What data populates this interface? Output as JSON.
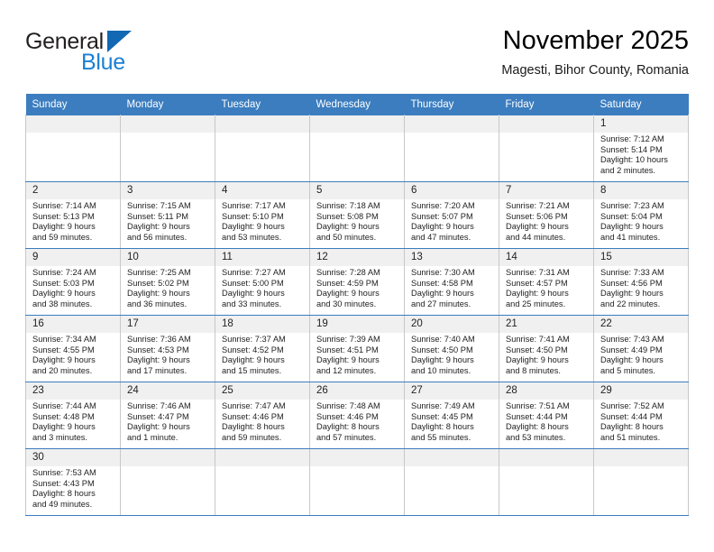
{
  "brand": {
    "name_top": "General",
    "name_bottom": "Blue",
    "accent_color": "#1268b3",
    "blue_text_color": "#1a7fd4"
  },
  "header": {
    "title": "November 2025",
    "subtitle": "Magesti, Bihor County, Romania"
  },
  "calendar": {
    "header_bg": "#3b7dbf",
    "daynum_bg": "#f0f0f0",
    "weekdays": [
      "Sunday",
      "Monday",
      "Tuesday",
      "Wednesday",
      "Thursday",
      "Friday",
      "Saturday"
    ],
    "weeks": [
      [
        {
          "day": "",
          "sunrise": "",
          "sunset": "",
          "daylight": "",
          "daylight2": ""
        },
        {
          "day": "",
          "sunrise": "",
          "sunset": "",
          "daylight": "",
          "daylight2": ""
        },
        {
          "day": "",
          "sunrise": "",
          "sunset": "",
          "daylight": "",
          "daylight2": ""
        },
        {
          "day": "",
          "sunrise": "",
          "sunset": "",
          "daylight": "",
          "daylight2": ""
        },
        {
          "day": "",
          "sunrise": "",
          "sunset": "",
          "daylight": "",
          "daylight2": ""
        },
        {
          "day": "",
          "sunrise": "",
          "sunset": "",
          "daylight": "",
          "daylight2": ""
        },
        {
          "day": "1",
          "sunrise": "Sunrise: 7:12 AM",
          "sunset": "Sunset: 5:14 PM",
          "daylight": "Daylight: 10 hours",
          "daylight2": "and 2 minutes."
        }
      ],
      [
        {
          "day": "2",
          "sunrise": "Sunrise: 7:14 AM",
          "sunset": "Sunset: 5:13 PM",
          "daylight": "Daylight: 9 hours",
          "daylight2": "and 59 minutes."
        },
        {
          "day": "3",
          "sunrise": "Sunrise: 7:15 AM",
          "sunset": "Sunset: 5:11 PM",
          "daylight": "Daylight: 9 hours",
          "daylight2": "and 56 minutes."
        },
        {
          "day": "4",
          "sunrise": "Sunrise: 7:17 AM",
          "sunset": "Sunset: 5:10 PM",
          "daylight": "Daylight: 9 hours",
          "daylight2": "and 53 minutes."
        },
        {
          "day": "5",
          "sunrise": "Sunrise: 7:18 AM",
          "sunset": "Sunset: 5:08 PM",
          "daylight": "Daylight: 9 hours",
          "daylight2": "and 50 minutes."
        },
        {
          "day": "6",
          "sunrise": "Sunrise: 7:20 AM",
          "sunset": "Sunset: 5:07 PM",
          "daylight": "Daylight: 9 hours",
          "daylight2": "and 47 minutes."
        },
        {
          "day": "7",
          "sunrise": "Sunrise: 7:21 AM",
          "sunset": "Sunset: 5:06 PM",
          "daylight": "Daylight: 9 hours",
          "daylight2": "and 44 minutes."
        },
        {
          "day": "8",
          "sunrise": "Sunrise: 7:23 AM",
          "sunset": "Sunset: 5:04 PM",
          "daylight": "Daylight: 9 hours",
          "daylight2": "and 41 minutes."
        }
      ],
      [
        {
          "day": "9",
          "sunrise": "Sunrise: 7:24 AM",
          "sunset": "Sunset: 5:03 PM",
          "daylight": "Daylight: 9 hours",
          "daylight2": "and 38 minutes."
        },
        {
          "day": "10",
          "sunrise": "Sunrise: 7:25 AM",
          "sunset": "Sunset: 5:02 PM",
          "daylight": "Daylight: 9 hours",
          "daylight2": "and 36 minutes."
        },
        {
          "day": "11",
          "sunrise": "Sunrise: 7:27 AM",
          "sunset": "Sunset: 5:00 PM",
          "daylight": "Daylight: 9 hours",
          "daylight2": "and 33 minutes."
        },
        {
          "day": "12",
          "sunrise": "Sunrise: 7:28 AM",
          "sunset": "Sunset: 4:59 PM",
          "daylight": "Daylight: 9 hours",
          "daylight2": "and 30 minutes."
        },
        {
          "day": "13",
          "sunrise": "Sunrise: 7:30 AM",
          "sunset": "Sunset: 4:58 PM",
          "daylight": "Daylight: 9 hours",
          "daylight2": "and 27 minutes."
        },
        {
          "day": "14",
          "sunrise": "Sunrise: 7:31 AM",
          "sunset": "Sunset: 4:57 PM",
          "daylight": "Daylight: 9 hours",
          "daylight2": "and 25 minutes."
        },
        {
          "day": "15",
          "sunrise": "Sunrise: 7:33 AM",
          "sunset": "Sunset: 4:56 PM",
          "daylight": "Daylight: 9 hours",
          "daylight2": "and 22 minutes."
        }
      ],
      [
        {
          "day": "16",
          "sunrise": "Sunrise: 7:34 AM",
          "sunset": "Sunset: 4:55 PM",
          "daylight": "Daylight: 9 hours",
          "daylight2": "and 20 minutes."
        },
        {
          "day": "17",
          "sunrise": "Sunrise: 7:36 AM",
          "sunset": "Sunset: 4:53 PM",
          "daylight": "Daylight: 9 hours",
          "daylight2": "and 17 minutes."
        },
        {
          "day": "18",
          "sunrise": "Sunrise: 7:37 AM",
          "sunset": "Sunset: 4:52 PM",
          "daylight": "Daylight: 9 hours",
          "daylight2": "and 15 minutes."
        },
        {
          "day": "19",
          "sunrise": "Sunrise: 7:39 AM",
          "sunset": "Sunset: 4:51 PM",
          "daylight": "Daylight: 9 hours",
          "daylight2": "and 12 minutes."
        },
        {
          "day": "20",
          "sunrise": "Sunrise: 7:40 AM",
          "sunset": "Sunset: 4:50 PM",
          "daylight": "Daylight: 9 hours",
          "daylight2": "and 10 minutes."
        },
        {
          "day": "21",
          "sunrise": "Sunrise: 7:41 AM",
          "sunset": "Sunset: 4:50 PM",
          "daylight": "Daylight: 9 hours",
          "daylight2": "and 8 minutes."
        },
        {
          "day": "22",
          "sunrise": "Sunrise: 7:43 AM",
          "sunset": "Sunset: 4:49 PM",
          "daylight": "Daylight: 9 hours",
          "daylight2": "and 5 minutes."
        }
      ],
      [
        {
          "day": "23",
          "sunrise": "Sunrise: 7:44 AM",
          "sunset": "Sunset: 4:48 PM",
          "daylight": "Daylight: 9 hours",
          "daylight2": "and 3 minutes."
        },
        {
          "day": "24",
          "sunrise": "Sunrise: 7:46 AM",
          "sunset": "Sunset: 4:47 PM",
          "daylight": "Daylight: 9 hours",
          "daylight2": "and 1 minute."
        },
        {
          "day": "25",
          "sunrise": "Sunrise: 7:47 AM",
          "sunset": "Sunset: 4:46 PM",
          "daylight": "Daylight: 8 hours",
          "daylight2": "and 59 minutes."
        },
        {
          "day": "26",
          "sunrise": "Sunrise: 7:48 AM",
          "sunset": "Sunset: 4:46 PM",
          "daylight": "Daylight: 8 hours",
          "daylight2": "and 57 minutes."
        },
        {
          "day": "27",
          "sunrise": "Sunrise: 7:49 AM",
          "sunset": "Sunset: 4:45 PM",
          "daylight": "Daylight: 8 hours",
          "daylight2": "and 55 minutes."
        },
        {
          "day": "28",
          "sunrise": "Sunrise: 7:51 AM",
          "sunset": "Sunset: 4:44 PM",
          "daylight": "Daylight: 8 hours",
          "daylight2": "and 53 minutes."
        },
        {
          "day": "29",
          "sunrise": "Sunrise: 7:52 AM",
          "sunset": "Sunset: 4:44 PM",
          "daylight": "Daylight: 8 hours",
          "daylight2": "and 51 minutes."
        }
      ],
      [
        {
          "day": "30",
          "sunrise": "Sunrise: 7:53 AM",
          "sunset": "Sunset: 4:43 PM",
          "daylight": "Daylight: 8 hours",
          "daylight2": "and 49 minutes."
        },
        {
          "day": "",
          "sunrise": "",
          "sunset": "",
          "daylight": "",
          "daylight2": ""
        },
        {
          "day": "",
          "sunrise": "",
          "sunset": "",
          "daylight": "",
          "daylight2": ""
        },
        {
          "day": "",
          "sunrise": "",
          "sunset": "",
          "daylight": "",
          "daylight2": ""
        },
        {
          "day": "",
          "sunrise": "",
          "sunset": "",
          "daylight": "",
          "daylight2": ""
        },
        {
          "day": "",
          "sunrise": "",
          "sunset": "",
          "daylight": "",
          "daylight2": ""
        },
        {
          "day": "",
          "sunrise": "",
          "sunset": "",
          "daylight": "",
          "daylight2": ""
        }
      ]
    ]
  }
}
